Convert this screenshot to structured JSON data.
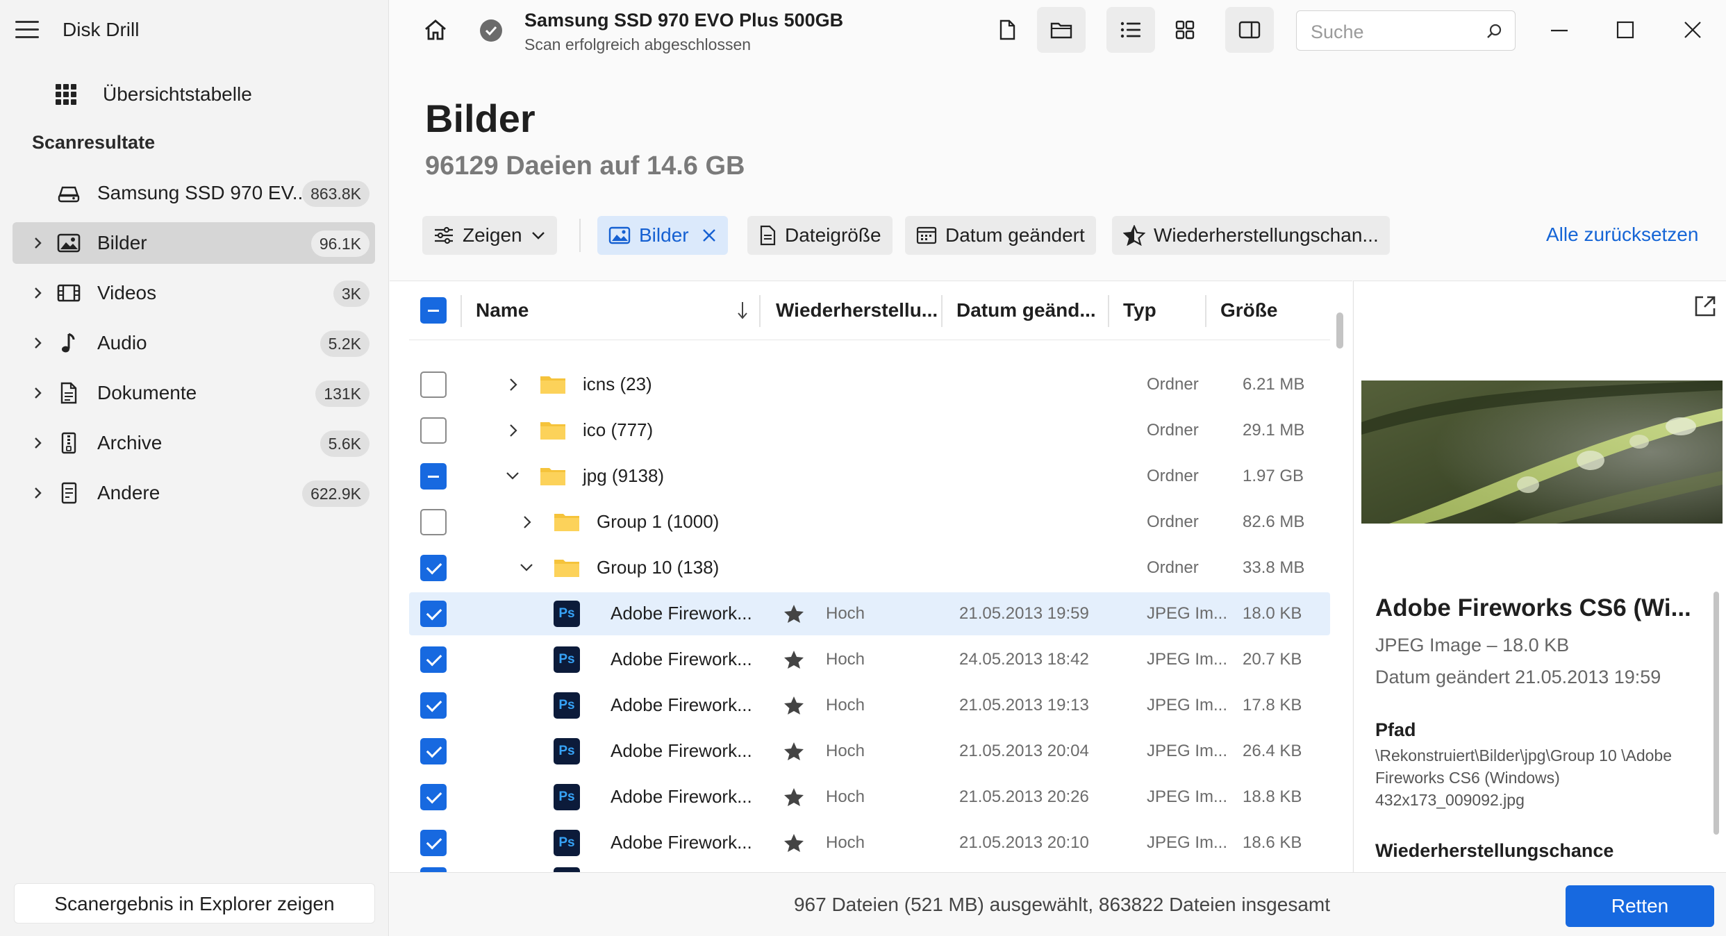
{
  "app": {
    "title": "Disk Drill"
  },
  "sidebar": {
    "overview": "Übersichtstabelle",
    "section": "Scanresultate",
    "device": {
      "label": "Samsung SSD 970 EV...",
      "count": "863.8K"
    },
    "items": [
      {
        "label": "Bilder",
        "count": "96.1K",
        "icon": "image-icon",
        "selected": true
      },
      {
        "label": "Videos",
        "count": "3K",
        "icon": "film-icon"
      },
      {
        "label": "Audio",
        "count": "5.2K",
        "icon": "music-note-icon"
      },
      {
        "label": "Dokumente",
        "count": "131K",
        "icon": "document-icon"
      },
      {
        "label": "Archive",
        "count": "5.6K",
        "icon": "archive-icon"
      },
      {
        "label": "Andere",
        "count": "622.9K",
        "icon": "other-file-icon"
      }
    ],
    "explorer_button": "Scanergebnis in Explorer zeigen"
  },
  "header": {
    "device": "Samsung SSD 970 EVO Plus 500GB",
    "status": "Scan erfolgreich abgeschlossen",
    "search_placeholder": "Suche"
  },
  "main": {
    "title": "Bilder",
    "subtitle": "96129 Daeien auf 14.6 GB"
  },
  "filters": {
    "show": "Zeigen",
    "images": "Bilder",
    "size": "Dateigröße",
    "date": "Datum geändert",
    "chance": "Wiederherstellungschan...",
    "reset": "Alle zurücksetzen"
  },
  "table": {
    "columns": {
      "name": "Name",
      "recovery": "Wiederherstellu...",
      "date": "Datum geänd...",
      "type": "Typ",
      "size": "Größe"
    },
    "folders": [
      {
        "name": "icns (23)",
        "type": "Ordner",
        "size": "6.21 MB"
      },
      {
        "name": "ico (777)",
        "type": "Ordner",
        "size": "29.1 MB"
      },
      {
        "name": "jpg (9138)",
        "type": "Ordner",
        "size": "1.97 GB"
      },
      {
        "name": "Group 1 (1000)",
        "type": "Ordner",
        "size": "82.6 MB"
      },
      {
        "name": "Group 10 (138)",
        "type": "Ordner",
        "size": "33.8 MB"
      }
    ],
    "files": [
      {
        "name": "Adobe Firework...",
        "chance": "Hoch",
        "date": "21.05.2013 19:59",
        "type": "JPEG Im...",
        "size": "18.0 KB"
      },
      {
        "name": "Adobe Firework...",
        "chance": "Hoch",
        "date": "24.05.2013 18:42",
        "type": "JPEG Im...",
        "size": "20.7 KB"
      },
      {
        "name": "Adobe Firework...",
        "chance": "Hoch",
        "date": "21.05.2013 19:13",
        "type": "JPEG Im...",
        "size": "17.8 KB"
      },
      {
        "name": "Adobe Firework...",
        "chance": "Hoch",
        "date": "21.05.2013 20:04",
        "type": "JPEG Im...",
        "size": "26.4 KB"
      },
      {
        "name": "Adobe Firework...",
        "chance": "Hoch",
        "date": "21.05.2013 20:26",
        "type": "JPEG Im...",
        "size": "18.8 KB"
      },
      {
        "name": "Adobe Firework...",
        "chance": "Hoch",
        "date": "21.05.2013 20:10",
        "type": "JPEG Im...",
        "size": "18.6 KB"
      }
    ]
  },
  "preview": {
    "title": "Adobe Fireworks CS6 (Wi...",
    "meta": "JPEG Image – 18.0 KB",
    "date": "Datum geändert 21.05.2013 19:59",
    "path_label": "Pfad",
    "path": "\\Rekonstruiert\\Bilder\\jpg\\Group 10 \\Adobe Fireworks CS6 (Windows) 432x173_009092.jpg",
    "chance_label": "Wiederherstellungschance"
  },
  "footer": {
    "summary": "967 Dateien (521 MB) ausgewählt, 863822 Dateien insgesamt",
    "button": "Retten"
  },
  "colors": {
    "accent": "#1769e0",
    "selection": "#e4effc"
  }
}
